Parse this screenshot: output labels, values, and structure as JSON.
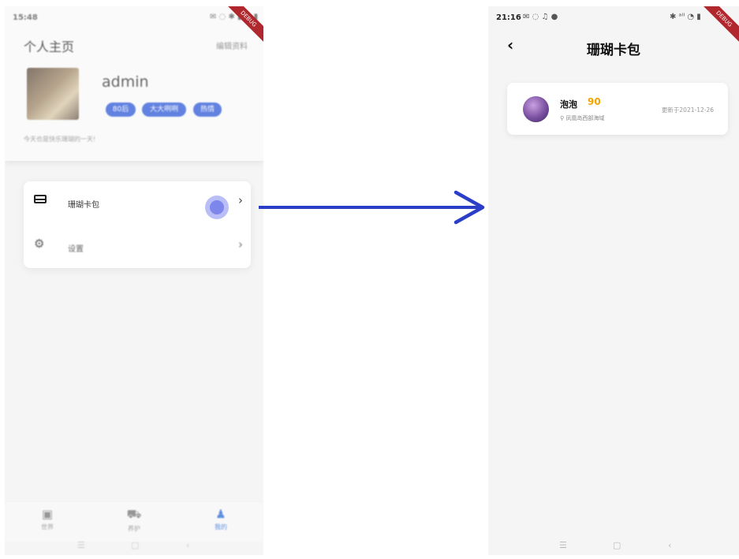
{
  "left": {
    "status": {
      "time": "15:48",
      "icons": "✉ ◌  ✱ ▮ ◔ ▮"
    },
    "ribbon": "DEBUG",
    "header": {
      "title": "个人主页",
      "edit": "编辑资料"
    },
    "profile": {
      "name": "admin",
      "tags": [
        "80后",
        "大大咧咧",
        "热情"
      ],
      "signature": "今天也是快乐珊瑚的一天!"
    },
    "menu": [
      {
        "label": "珊瑚卡包",
        "icon": "card-icon"
      },
      {
        "label": "设置",
        "icon": "gear-icon"
      }
    ],
    "tabs": [
      {
        "label": "世界",
        "icon": "shop-icon"
      },
      {
        "label": "养护",
        "icon": "cart-icon"
      },
      {
        "label": "我的",
        "icon": "person-icon"
      }
    ],
    "nav": [
      "☰",
      "▢",
      "‹"
    ]
  },
  "right": {
    "status": {
      "time": "21:16",
      "icons": "✉ ◌ ♫ ●",
      "right_icons": "✱ ᵃᴵᴵ ◔ ▮"
    },
    "ribbon": "DEBUG",
    "title": "珊瑚卡包",
    "card": {
      "name": "泡泡",
      "score": "90",
      "location": "凤凰岛西部海域",
      "updated": "更新于2021-12-26"
    },
    "nav": [
      "☰",
      "▢",
      "‹"
    ]
  },
  "colors": {
    "arrow": "#2a3ec8",
    "tag": "#2f5ad8",
    "score": "#f0a400",
    "tab_active": "#2f6fd8"
  }
}
